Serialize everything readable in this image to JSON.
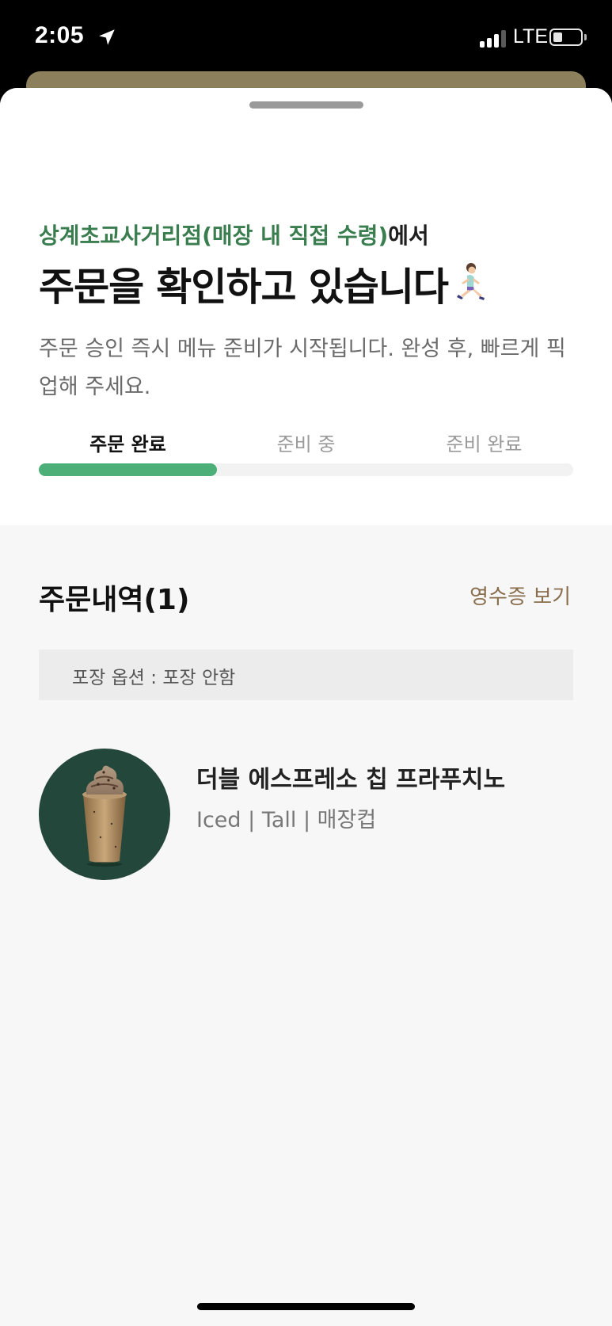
{
  "status_bar": {
    "time": "2:05",
    "network": "LTE",
    "icons": [
      "location-arrow-icon",
      "signal-icon",
      "battery-icon"
    ]
  },
  "order_status": {
    "store_name": "상계초교사거리점(매장 내 직접 수령)",
    "store_suffix": "에서",
    "headline": "주문을 확인하고 있습니다",
    "headline_emoji": "runner-icon",
    "description": "주문 승인 즉시 메뉴 준비가 시작됩니다. 완성 후, 빠르게 픽업해 주세요.",
    "steps": [
      {
        "label": "주문 완료",
        "state": "done"
      },
      {
        "label": "준비 중",
        "state": "todo"
      },
      {
        "label": "준비 완료",
        "state": "todo"
      }
    ],
    "progress_fraction": 0.333
  },
  "order_details": {
    "title": "주문내역(1)",
    "receipt_link": "영수증 보기",
    "packaging_option": "포장 옵션 : 포장 안함",
    "items": [
      {
        "name": "더블 에스프레소 칩 프라푸치노",
        "options": "Iced | Tall | 매장컵",
        "image_icon": "frappuccino-drink-icon"
      }
    ]
  },
  "colors": {
    "accent_green": "#3a7d4f",
    "progress_green": "#4daf78",
    "receipt_brown": "#8a6d4c",
    "item_bg": "#23473a"
  }
}
